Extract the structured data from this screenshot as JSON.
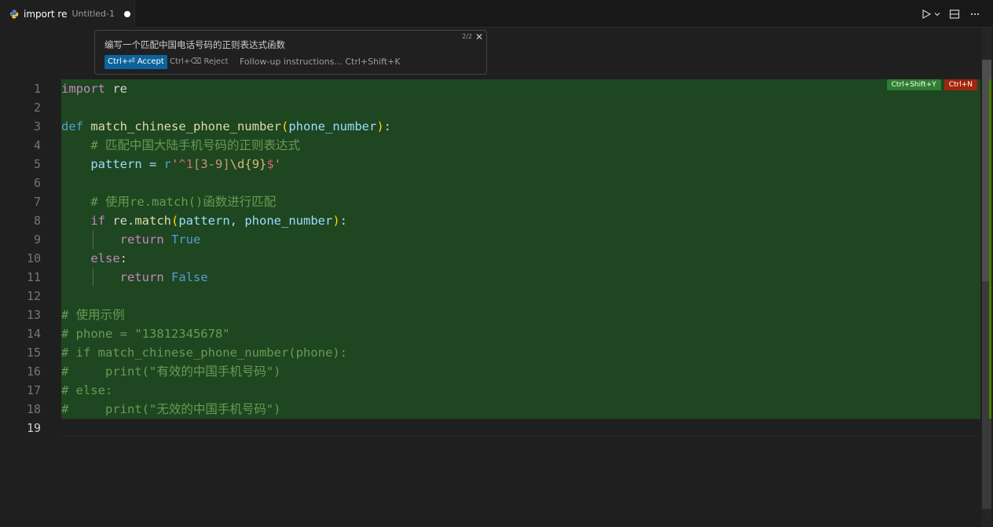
{
  "tab": {
    "title": "import re",
    "subtitle": "Untitled-1"
  },
  "actions": {
    "run_icon": "play-icon",
    "dropdown_icon": "chevron-down-icon",
    "split_icon": "split-editor-icon",
    "more_icon": "ellipsis-icon"
  },
  "inline_chat": {
    "prompt": "编写一个匹配中国电话号码的正则表达式函数",
    "counter": "2/2",
    "accept_label": "Ctrl+⏎ Accept",
    "reject_label": "Ctrl+⌫ Reject",
    "followup_placeholder": "Follow-up instructions... Ctrl+Shift+K"
  },
  "diff_badges": {
    "accept": "Ctrl+Shift+Y",
    "reject": "Ctrl+N"
  },
  "line_numbers": [
    "1",
    "2",
    "3",
    "4",
    "5",
    "6",
    "7",
    "8",
    "9",
    "10",
    "11",
    "12",
    "13",
    "14",
    "15",
    "16",
    "17",
    "18",
    "19"
  ],
  "code": {
    "l1_kw": "import",
    "l1_rest": " re",
    "l3_kw": "def",
    "l3_fn": "match_chinese_phone_number",
    "l3_p1": "(",
    "l3_param": "phone_number",
    "l3_p2": ")",
    "l3_colon": ":",
    "l4": "# 匹配中国大陆手机号码的正则表达式",
    "l5_var": "pattern = ",
    "l5_r": "r",
    "l5_q1": "'",
    "l5_rx1": "^1",
    "l5_cls": "[3-9]",
    "l5_esc": "\\d",
    "l5_q": "{9}",
    "l5_rx2": "$",
    "l5_q2": "'",
    "l7": "# 使用re.match()函数进行匹配",
    "l8_kw": "if",
    "l8_mid": " re.",
    "l8_fn": "match",
    "l8_p1": "(",
    "l8_args": "pattern, phone_number",
    "l8_p2": ")",
    "l8_colon": ":",
    "l9_kw": "return",
    "l9_val": "True",
    "l10_kw": "else",
    "l10_colon": ":",
    "l11_kw": "return",
    "l11_val": "False",
    "l13": "# 使用示例",
    "l14": "# phone = \"13812345678\"",
    "l15": "# if match_chinese_phone_number(phone):",
    "l16": "#     print(\"有效的中国手机号码\")",
    "l17": "# else:",
    "l18": "#     print(\"无效的中国手机号码\")"
  }
}
